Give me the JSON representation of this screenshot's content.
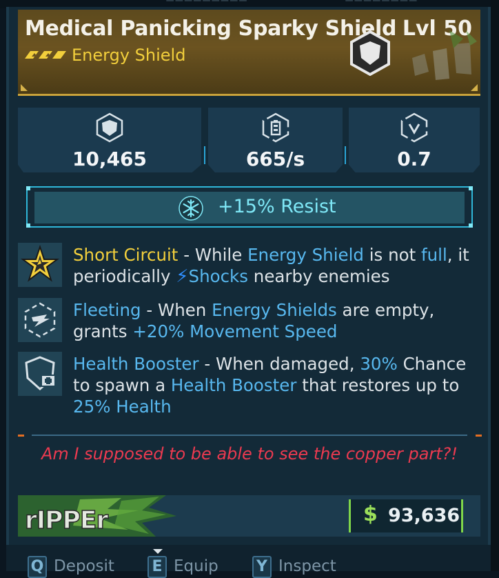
{
  "item": {
    "name": "Medical Panicking Sparky Shield",
    "level": "Lvl 50",
    "type": "Energy Shield",
    "rarity_color": "#f2cf3c"
  },
  "stats": [
    {
      "icon": "shield-capacity-icon",
      "value": "10,465"
    },
    {
      "icon": "recharge-rate-icon",
      "value": "665/s"
    },
    {
      "icon": "recharge-delay-icon",
      "value": "0.7"
    }
  ],
  "element": {
    "icon": "cryo-icon",
    "text": "+15% Resist"
  },
  "perks": [
    {
      "icon": "short-circuit-star-icon",
      "name": "Short Circuit",
      "s1": " - While ",
      "k1": "Energy Shield",
      "s2": " is not ",
      "k2": "full",
      "s3": ", it periodically ",
      "bolt": "⚡",
      "k3": "Shocks",
      "s4": " nearby enemies"
    },
    {
      "icon": "fleeting-icon",
      "name": "Fleeting",
      "s1": " - When ",
      "k1": "Energy Shields",
      "s2": " are empty, grants ",
      "k2": "+20% Movement Speed"
    },
    {
      "icon": "health-booster-icon",
      "name": "Health Booster",
      "s1": " - When damaged, ",
      "k1": "30%",
      "s2": " Chance to spawn a ",
      "k2": "Health Booster",
      "s3": " that restores up to ",
      "k3": "25% Health"
    }
  ],
  "flavor_text": "Am I supposed to be able to see the copper part?!",
  "manufacturer": {
    "logo": "ripper-logo",
    "name": "RIPPER"
  },
  "price": {
    "symbol": "$",
    "amount": "93,636"
  },
  "actions": [
    {
      "key": "Q",
      "label": "Deposit"
    },
    {
      "key": "E",
      "label": "Equip"
    },
    {
      "key": "Y",
      "label": "Inspect"
    }
  ],
  "colors": {
    "accent_cyan": "#2fb7d9",
    "keyword_blue": "#58b8ef",
    "flavor_red": "#ec3a50",
    "price_green": "#9be05a"
  }
}
